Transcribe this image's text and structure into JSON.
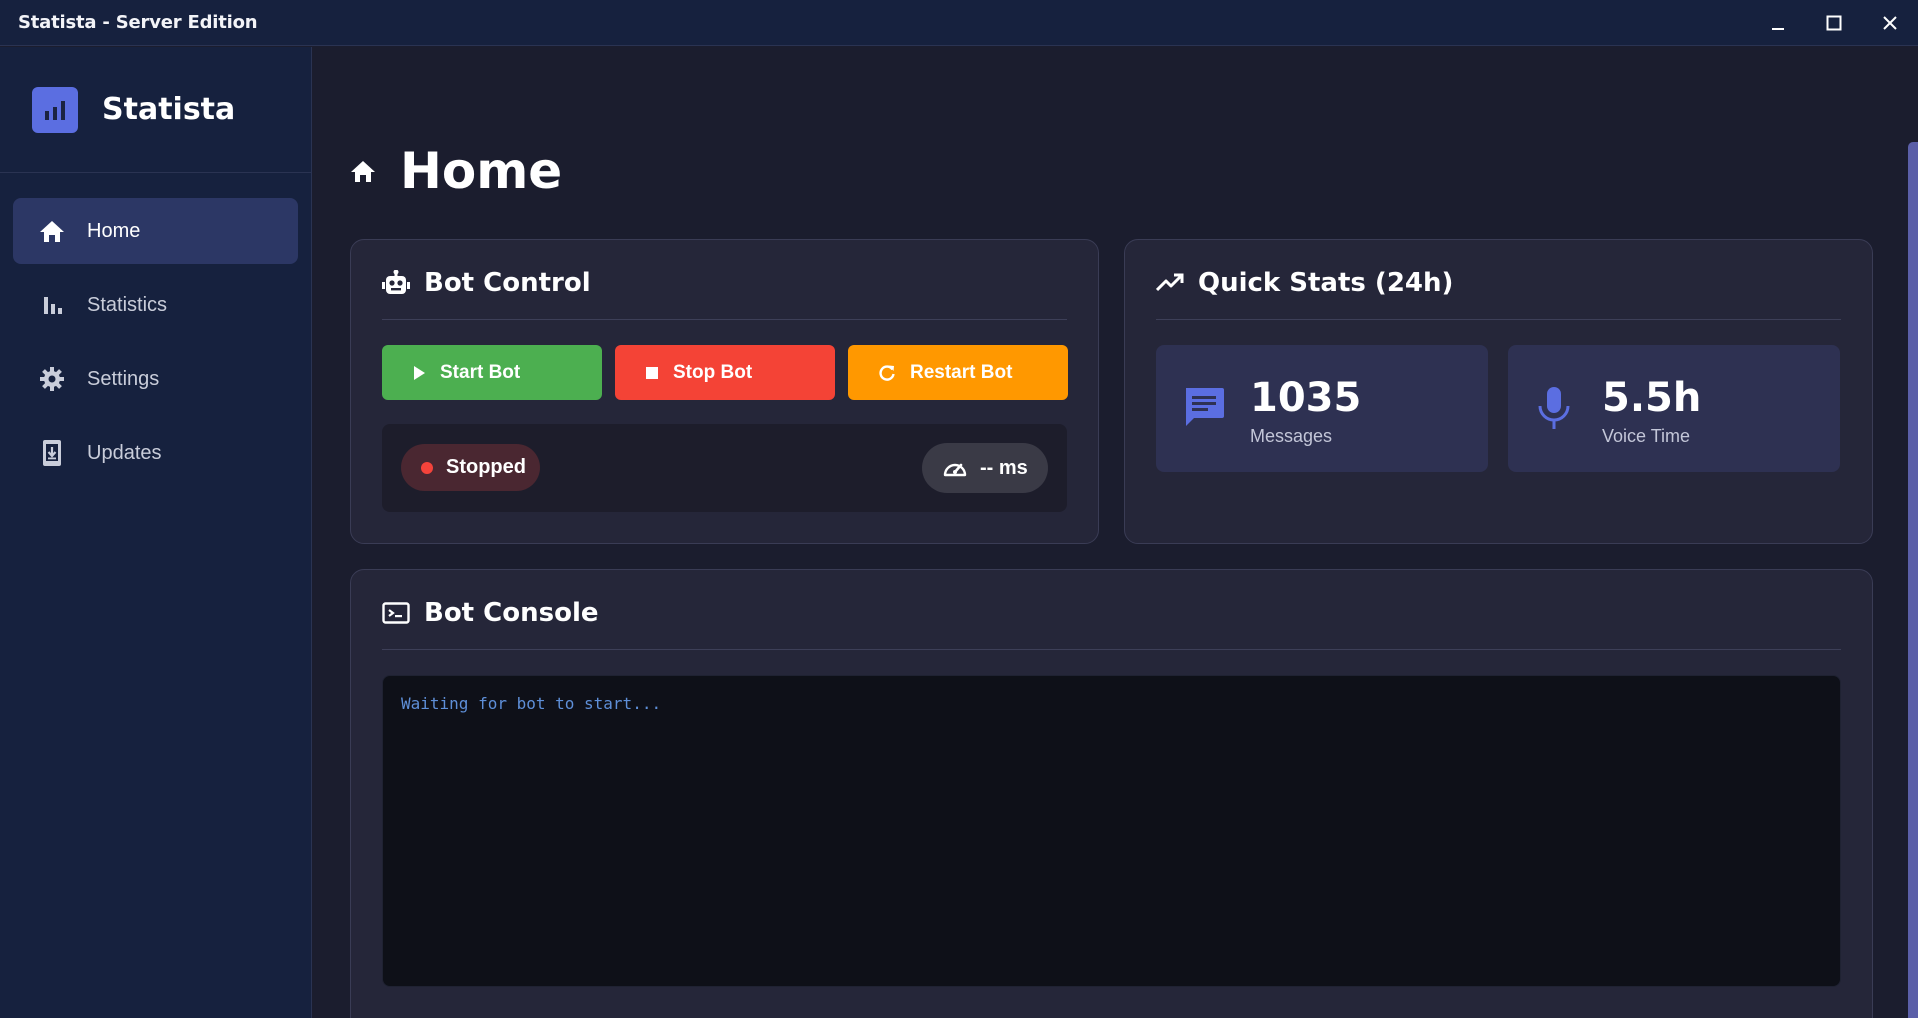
{
  "window": {
    "title": "Statista - Server Edition",
    "controls": [
      "minimize-icon",
      "maximize-icon",
      "close-icon"
    ]
  },
  "sidebar": {
    "brand": {
      "name": "Statista",
      "logo_icon": "bar-chart-icon",
      "logo_color": "#5b6ee1"
    },
    "items": [
      {
        "label": "Home",
        "icon": "home-icon",
        "active": true
      },
      {
        "label": "Statistics",
        "icon": "bar-chart-icon",
        "active": false
      },
      {
        "label": "Settings",
        "icon": "gear-icon",
        "active": false
      },
      {
        "label": "Updates",
        "icon": "download-icon",
        "active": false
      }
    ]
  },
  "page": {
    "title": "Home",
    "icon": "home-icon"
  },
  "bot_control": {
    "title": "Bot Control",
    "icon": "robot-icon",
    "buttons": {
      "start": {
        "label": "Start Bot",
        "color": "#4caf50",
        "icon": "play-icon"
      },
      "stop": {
        "label": "Stop Bot",
        "color": "#f44336",
        "icon": "stop-icon"
      },
      "restart": {
        "label": "Restart Bot",
        "color": "#ff9800",
        "icon": "refresh-icon"
      }
    },
    "status": {
      "label": "Stopped",
      "dot_color": "#f4433b"
    },
    "ping": {
      "label": "-- ms",
      "icon": "speedometer-icon"
    }
  },
  "quick_stats": {
    "title": "Quick Stats (24h)",
    "icon": "trending-up-icon",
    "messages": {
      "value": "1035",
      "label": "Messages",
      "icon": "message-icon"
    },
    "voice": {
      "value": "5.5h",
      "label": "Voice Time",
      "icon": "microphone-icon"
    },
    "accent": "#5b6ee1"
  },
  "console": {
    "title": "Bot Console",
    "icon": "terminal-icon",
    "text": "Waiting for bot to start..."
  }
}
